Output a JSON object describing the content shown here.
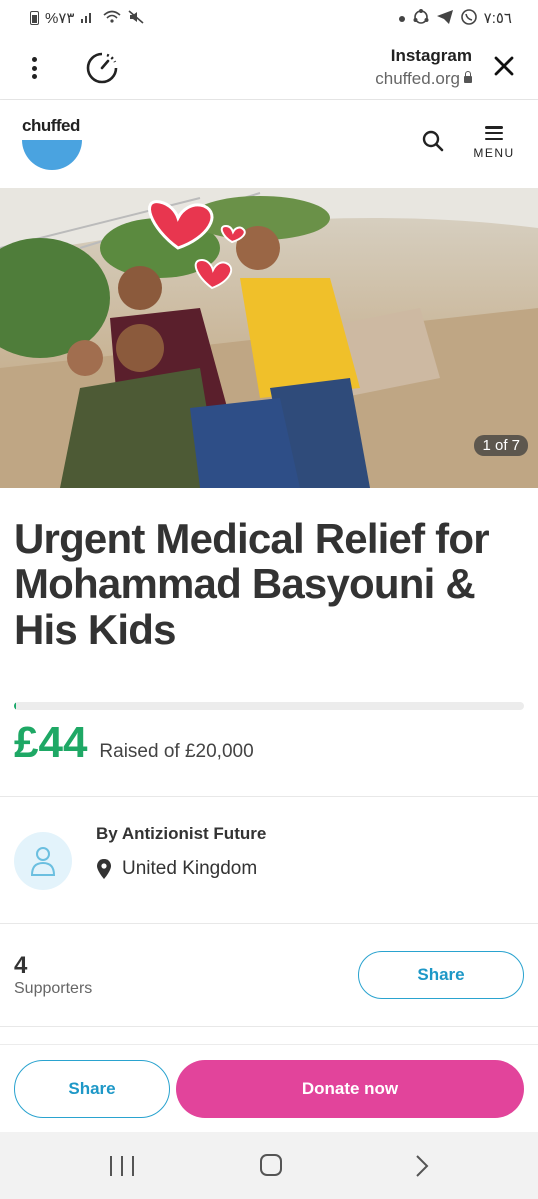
{
  "status_bar": {
    "left_text": "%٧٣",
    "time": "٧:٥٦"
  },
  "browser": {
    "app_title": "Instagram",
    "domain": "chuffed.org"
  },
  "site_header": {
    "logo_text": "chuffed",
    "menu_label": "MENU"
  },
  "hero": {
    "image_counter": "1 of 7"
  },
  "campaign": {
    "title": "Urgent Medical Relief for Mohammad Basyouni & His Kids",
    "raised_amount": "£44",
    "raised_of": "Raised of £20,000",
    "progress_fraction": 0.0022
  },
  "organizer": {
    "byline": "By Antizionist Future",
    "location": "United Kingdom"
  },
  "supporters": {
    "count": "4",
    "label": "Supporters",
    "share_label": "Share"
  },
  "action_bar": {
    "share_label": "Share",
    "donate_label": "Donate now"
  },
  "colors": {
    "accent_green": "#1ea865",
    "donate_pink": "#e2449b",
    "share_blue": "#1e98c7",
    "logo_blue": "#4aa3e0"
  }
}
